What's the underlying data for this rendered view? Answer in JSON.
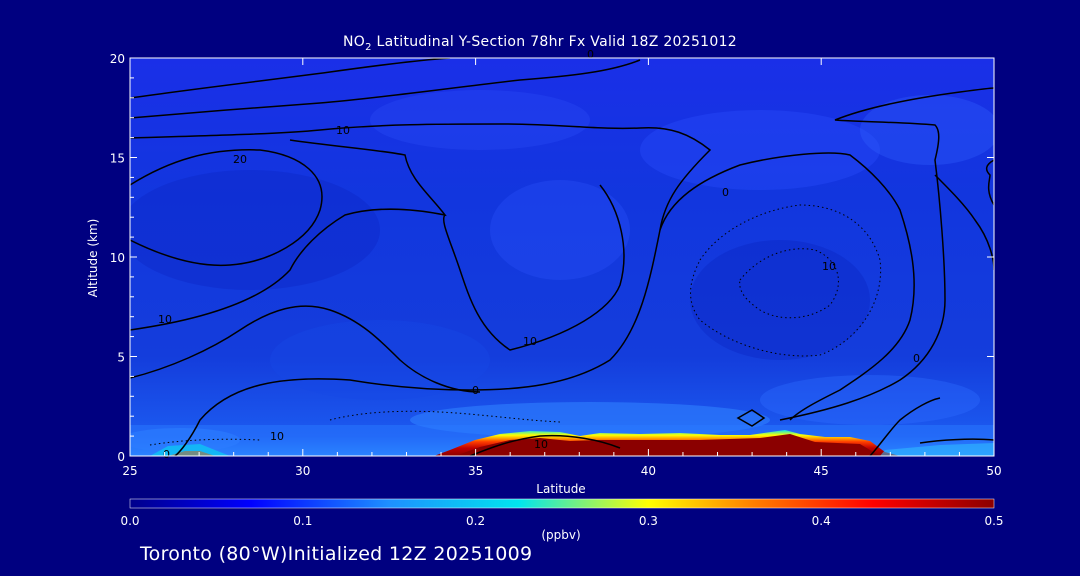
{
  "title": {
    "prefix": "NO",
    "sub": "2",
    "suffix": " Latitudinal Y-Section 78hr  Fx Valid 18Z 20251012"
  },
  "footer": "Toronto (80°W)Initialized 12Z 20251009",
  "chart_data": {
    "type": "heatmap",
    "xlabel": "Latitude",
    "ylabel": "Altitude (km)",
    "xlim": [
      25,
      50
    ],
    "ylim": [
      0,
      20
    ],
    "xticks": [
      25,
      30,
      35,
      40,
      45,
      50
    ],
    "yticks": [
      0,
      5,
      10,
      15,
      20
    ],
    "colorbar": {
      "label": "(ppbv)",
      "min": 0.0,
      "max": 0.5,
      "ticks": [
        0.0,
        0.1,
        0.2,
        0.3,
        0.4,
        0.5
      ],
      "tick_labels": [
        "0.0",
        "0.1",
        "0.2",
        "0.3",
        "0.4",
        "0.5"
      ],
      "colors": [
        "#00008b",
        "#0000ff",
        "#1e90ff",
        "#00e5ee",
        "#ffff00",
        "#ff8000",
        "#ff0000",
        "#8b0000"
      ]
    },
    "surface_no2_profile": {
      "latitude": [
        25,
        26,
        27,
        28,
        30,
        33,
        34.5,
        35,
        36,
        37,
        38,
        39,
        40,
        41,
        42,
        43,
        44,
        45,
        46,
        47,
        48,
        50
      ],
      "value_ppbv": [
        0.15,
        0.3,
        0.45,
        0.2,
        0.12,
        0.15,
        0.3,
        0.45,
        0.5,
        0.5,
        0.45,
        0.5,
        0.5,
        0.48,
        0.5,
        0.5,
        0.5,
        0.5,
        0.5,
        0.4,
        0.25,
        0.2
      ]
    },
    "contour_labels": [
      "0",
      "10",
      "20",
      "10",
      "10",
      "10",
      "0",
      "10",
      "0",
      "10",
      "0",
      "0"
    ]
  }
}
